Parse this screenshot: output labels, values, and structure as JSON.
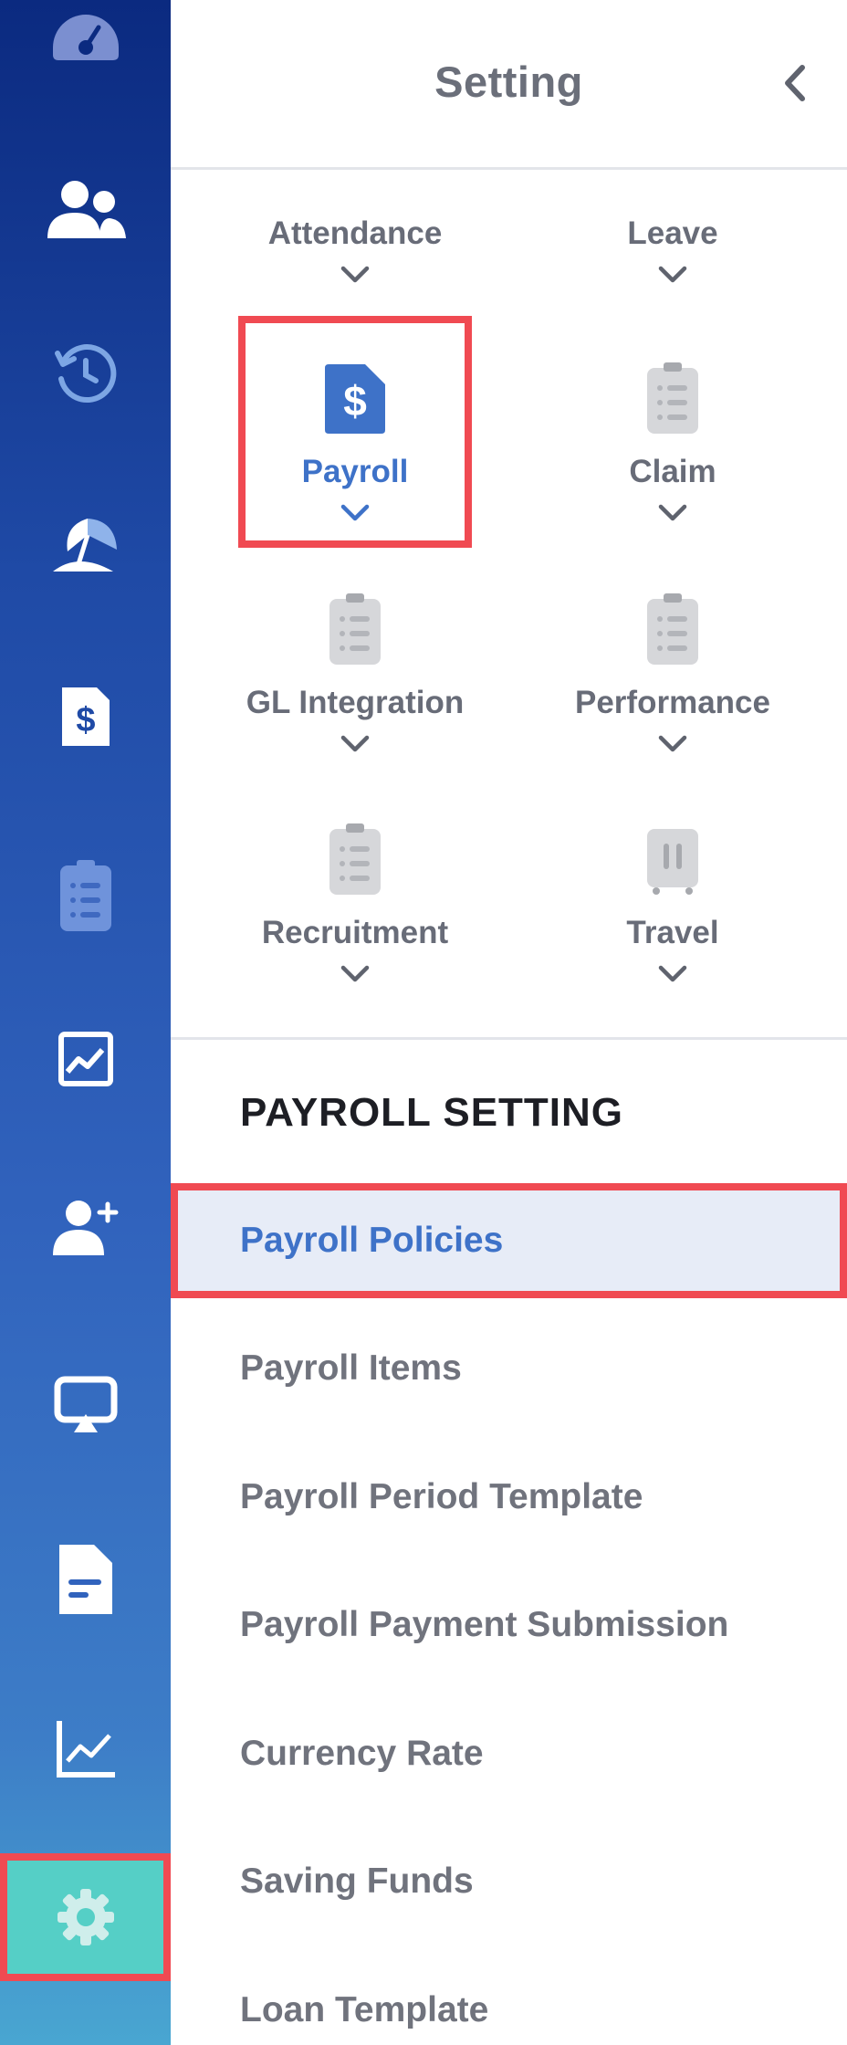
{
  "header": {
    "title": "Setting",
    "back_icon": "chevron-left-icon"
  },
  "rail": {
    "items": [
      {
        "icon": "dashboard-gauge-icon"
      },
      {
        "icon": "people-icon"
      },
      {
        "icon": "history-clock-icon"
      },
      {
        "icon": "beach-umbrella-icon"
      },
      {
        "icon": "payroll-document-icon"
      },
      {
        "icon": "clipboard-icon"
      },
      {
        "icon": "performance-chart-icon"
      },
      {
        "icon": "add-user-icon"
      },
      {
        "icon": "presentation-icon"
      },
      {
        "icon": "document-icon"
      },
      {
        "icon": "line-chart-icon"
      },
      {
        "icon": "settings-gear-icon",
        "active": true
      }
    ]
  },
  "modules": [
    {
      "label": "Attendance"
    },
    {
      "label": "Leave"
    },
    {
      "label": "Payroll",
      "icon": "payroll-dollar-icon",
      "active": true
    },
    {
      "label": "Claim",
      "icon": "clipboard-icon"
    },
    {
      "label": "GL Integration",
      "icon": "clipboard-icon"
    },
    {
      "label": "Performance",
      "icon": "clipboard-icon"
    },
    {
      "label": "Recruitment",
      "icon": "clipboard-icon"
    },
    {
      "label": "Travel",
      "icon": "luggage-icon"
    }
  ],
  "section": {
    "title": "PAYROLL SETTING"
  },
  "menu": [
    {
      "label": "Payroll Policies",
      "active": true
    },
    {
      "label": "Payroll Items"
    },
    {
      "label": "Payroll Period Template"
    },
    {
      "label": "Payroll Payment Submission"
    },
    {
      "label": "Currency Rate"
    },
    {
      "label": "Saving Funds"
    },
    {
      "label": "Loan Template"
    }
  ],
  "colors": {
    "accent": "#3e72c8",
    "highlight": "#f04a52",
    "active_rail": "#55cfc6",
    "active_row_bg": "#e7ecf7"
  }
}
